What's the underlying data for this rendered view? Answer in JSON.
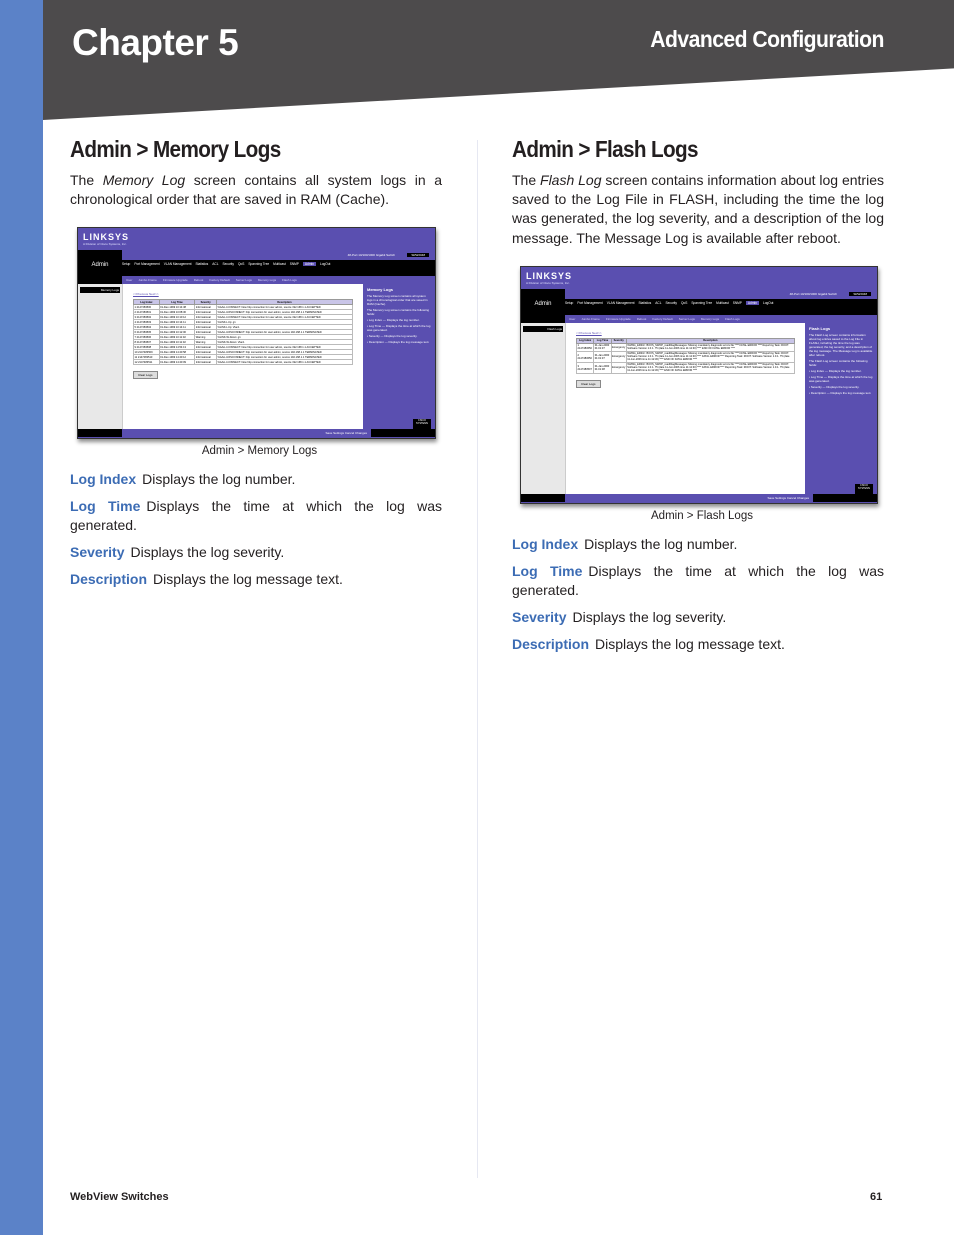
{
  "header": {
    "chapter": "Chapter 5",
    "section": "Advanced Configuration"
  },
  "left": {
    "title": "Admin > Memory Logs",
    "intro_pre": "The ",
    "intro_em": "Memory Log",
    "intro_post": " screen contains all system logs in a chronological order that are saved in RAM (Cache).",
    "caption": "Admin > Memory Logs",
    "screenshot": {
      "logo": "LINKSYS",
      "logo_sub": "A Division of Cisco Systems, Inc.",
      "page_label": "Admin",
      "model": "48-Port 10/100/1000 Gigabit Switch",
      "model_id": "SRW2048",
      "tabs": [
        "Setup",
        "Port Management",
        "VLAN Management",
        "Statistics",
        "ACL",
        "Security",
        "QoS",
        "Spanning Tree",
        "Multicast",
        "SNMP",
        "Admin",
        "LogOut"
      ],
      "subtabs": [
        "User",
        "Jumbo Frame",
        "Firmware Upgrade",
        "Reboot",
        "Factory Default",
        "Server Logs",
        "Memory Logs",
        "Flash Logs"
      ],
      "leftnav": "Memory Logs",
      "pager": "<<Previous  Next>>",
      "columns": [
        "Log Index",
        "Log Time",
        "Severity",
        "Description"
      ],
      "rows": [
        [
          "1",
          "2147483500",
          "01-Dec-1999 10:14:38",
          "Informational",
          "%AAA-I-CONNECT: New http connection for user admin, source 192.168.1.1 ACCEPTED"
        ],
        [
          "2",
          "2147483501",
          "01-Dec-1999 10:08:30",
          "Informational",
          "%AAA-I-DISCONNECT: http connection for user admin, source 192.168.1.1 TERMINATED"
        ],
        [
          "3",
          "2147483502",
          "01-Dec-1999 10:10:12",
          "Informational",
          "%AAA-I-CONNECT: New http connection for user admin, source 192.168.1.1 ACCEPTED"
        ],
        [
          "4",
          "2147483503",
          "01-Dec-1999 10:14:11",
          "Informational",
          "%LINK-I-Up: g1"
        ],
        [
          "5",
          "2147483504",
          "01-Dec-1999 10:14:11",
          "Informational",
          "%LINK-I-Up: Vlan1"
        ],
        [
          "6",
          "2147483505",
          "01-Dec-1999 10:12:00",
          "Informational",
          "%AAA-I-DISCONNECT: http connection for user admin, source 192.168.1.1 TERMINATED"
        ],
        [
          "7",
          "2147483506",
          "01-Dec-1999 10:11:02",
          "Warning",
          "%LINK-W-Down: g1"
        ],
        [
          "8",
          "2147483507",
          "01-Dec-1999 10:11:02",
          "Warning",
          "%LINK-W-Down: Vlan1"
        ],
        [
          "9",
          "2147483508",
          "01-Dec-1999 14:54:13",
          "Informational",
          "%AAA-I-CONNECT: New http connection for user admin, source 192.168.1.1 ACCEPTED"
        ],
        [
          "10",
          "2147483509",
          "01-Dec-1999 14:40:58",
          "Informational",
          "%AAA-I-DISCONNECT: http connection for user admin, source 192.168.1.1 TERMINATED"
        ],
        [
          "11",
          "2147483510",
          "01-Dec-1999 14:40:12",
          "Informational",
          "%AAA-I-DISCONNECT: http connection for user admin, source 192.168.1.1 TERMINATED"
        ],
        [
          "12",
          "2147483511",
          "01-Dec-1999 14:40:09",
          "Informational",
          "%AAA-I-CONNECT: New http connection for user admin, source 192.168.1.1 ACCEPTED"
        ]
      ],
      "clear_button": "Clear Logs",
      "help_title": "Memory Logs",
      "help_lines": [
        "The Memory Log screen contains all system logs in a chronological order that are saved in RAM (Cache).",
        "The Memory Log screen contains the following fields:",
        "• Log Index — Displays the log number.",
        "• Log Time — Displays the time at which the log was generated.",
        "• Severity — Displays the log severity.",
        "• Description — Displays the log message text."
      ],
      "footer_actions": "Save Settings  Cancel Changes",
      "cisco": "CISCO SYSTEMS"
    },
    "defs": [
      {
        "term": "Log Index",
        "text": "Displays the log number."
      },
      {
        "term": "Log Time",
        "text": "Displays the time at which the log was generated."
      },
      {
        "term": "Severity",
        "text": "Displays the log severity."
      },
      {
        "term": "Description",
        "text": "Displays the log message text."
      }
    ]
  },
  "right": {
    "title": "Admin > Flash Logs",
    "intro_pre": "The ",
    "intro_em": "Flash Log",
    "intro_post": " screen contains information about log entries saved to the Log File in FLASH, including the time the log was generated, the log severity, and a description of the log message. The Message Log is available after reboot.",
    "caption": "Admin > Flash Logs",
    "screenshot": {
      "logo": "LINKSYS",
      "logo_sub": "A Division of Cisco Systems, Inc.",
      "page_label": "Admin",
      "model": "48-Port 10/100/1000 Gigabit Switch",
      "model_id": "SRW2048",
      "tabs": [
        "Setup",
        "Port Management",
        "VLAN Management",
        "Statistics",
        "ACL",
        "Security",
        "QoS",
        "Spanning Tree",
        "Multicast",
        "SNMP",
        "Admin",
        "LogOut"
      ],
      "subtabs": [
        "User",
        "Jumbo Frame",
        "Firmware Upgrade",
        "Reboot",
        "Factory Default",
        "Server Logs",
        "Memory Logs",
        "Flash Logs"
      ],
      "leftnav": "Flash Logs",
      "pager": "<<Previous  Next>>",
      "columns": [
        "Log Index",
        "Log Time",
        "Severity",
        "Description"
      ],
      "rows": [
        [
          "1",
          "2147483650",
          "01-Jan-2000 01:01:37",
          "Emergency",
          "%MNG_ERR-F: BOXS_SWOP_readDiagMessages: Missing mandatory diagnostic errors file **** FATAL ERROR **** Reporting Task: ROOT. Software Version 1.0.1. 75 (date 11-Jun-2006 time 11:12:30) **** END OF FATAL ERROR ****"
        ],
        [
          "2",
          "2147483650",
          "01-Jan-2000 01:01:37",
          "Emergency",
          "%MNG_ERR-F: BOXS_SWOP_readDiagMessages: Missing mandatory diagnostic errors file **** FATAL ERROR **** Reporting Task: ROOT. Software Version 1.0.1. 75 (date 11-Jun-2006 time 11:12:30) **** FATAL ERROR **** Reporting Task: ROOT. Software Version 1.0.1. 75 (date 11-Jun-2006 time 11:12:30) **** END OF FATAL ERROR ****"
        ],
        [
          "3",
          "2147483507",
          "01-Jan-2000 01:01:38",
          "Emergency",
          "%MNG_ERR-F: BOXS_SWOP_readDiagMessages: Missing mandatory diagnostic errors file **** FATAL ERROR **** Reporting Task: ROOT. Software Version 1.0.1. 75 (date 11-Jun-2006 time 11:12:30) **** FATAL ERROR **** Reporting Task: ROOT. Software Version 1.0.1. 75 (date 11-Jun-2006 time 11:12:30) **** END OF FATAL ERROR ****"
        ]
      ],
      "clear_button": "Clear Logs",
      "help_title": "Flash Logs",
      "help_lines": [
        "The Flash Log screen contains information about log entries saved to the Log File in FLASH, including the time the log was generated, the log severity, and a description of the log message. The Message Log is available after reboot.",
        "The Flash Log screen contains the following fields:",
        "• Log Index — Displays the log number.",
        "• Log Time — Displays the time at which the log was generated.",
        "• Severity — Displays the log severity.",
        "• Description — Displays the log message text."
      ],
      "footer_actions": "Save Settings  Cancel Changes",
      "cisco": "CISCO SYSTEMS"
    },
    "defs": [
      {
        "term": "Log Index",
        "text": "Displays the log number."
      },
      {
        "term": "Log Time",
        "text": "Displays the time at which the log was generated."
      },
      {
        "term": "Severity",
        "text": "Displays the log severity."
      },
      {
        "term": "Description",
        "text": "Displays the log message text."
      }
    ]
  },
  "footer": {
    "left": "WebView Switches",
    "page": "61"
  }
}
